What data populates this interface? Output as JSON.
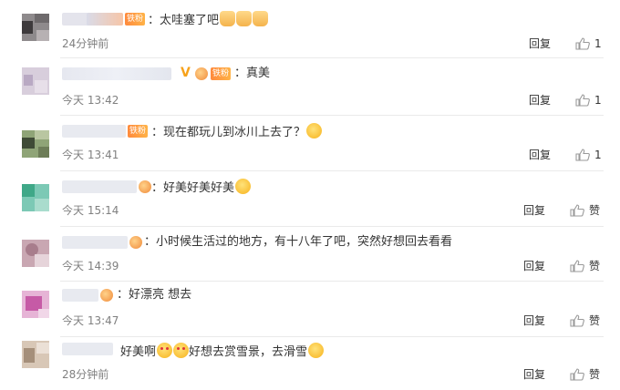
{
  "comments": [
    {
      "badge": "铁粉",
      "text": "太哇塞了吧",
      "emoji": [
        "thumbs-up-emoji",
        "thumbs-up-emoji",
        "thumbs-up-emoji"
      ],
      "time": "24分钟前",
      "reply": "回复",
      "like_label": "1"
    },
    {
      "badge": "",
      "text": "真美",
      "emoji": [],
      "time": "今天 13:42",
      "reply": "回复",
      "like_label": "1"
    },
    {
      "badge": "铁粉",
      "text": "现在都玩儿到冰川上去了？",
      "emoji": [
        "surprised-face-emoji"
      ],
      "time": "今天 13:41",
      "reply": "回复",
      "like_label": "1"
    },
    {
      "badge": "",
      "text": "好美好美好美",
      "emoji": [
        "surprised-face-emoji"
      ],
      "time": "今天 15:14",
      "reply": "回复",
      "like_label": "赞"
    },
    {
      "badge": "",
      "text": "小时候生活过的地方，有十八年了吧，突然好想回去看看",
      "emoji": [],
      "time": "今天 14:39",
      "reply": "回复",
      "like_label": "赞"
    },
    {
      "badge": "",
      "text": "好漂亮 想去",
      "emoji": [],
      "time": "今天 13:47",
      "reply": "回复",
      "like_label": "赞"
    },
    {
      "badge": "",
      "text": "好美啊",
      "text2": "好想去赏雪景，去滑雪",
      "emoji": [
        "love-eyes-emoji",
        "love-eyes-emoji"
      ],
      "emoji_end": [
        "surprised-face-emoji"
      ],
      "time": "28分钟前",
      "reply": "回复",
      "like_label": "赞"
    }
  ],
  "colors": {
    "text": "#333333",
    "time": "#808080",
    "separator": "#eaeaea",
    "badge": "#ff8a3d",
    "icon": "#9a9a9a"
  }
}
